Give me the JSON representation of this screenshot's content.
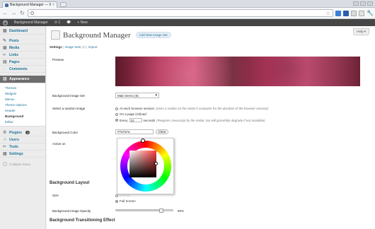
{
  "browser": {
    "tab_title": "Background Manager — W",
    "tab_close": "×",
    "address": "",
    "bookmark_star": "☆"
  },
  "adminbar": {
    "site_name": "Background Manager",
    "updates": "⟳ 1",
    "comments": "💬",
    "new": "+ New"
  },
  "sidebar": {
    "top_items": [
      {
        "label": "Dashboard",
        "icon": "dashboard-icon"
      }
    ],
    "items": [
      {
        "label": "Posts",
        "icon": "posts-icon"
      },
      {
        "label": "Media",
        "icon": "media-icon"
      },
      {
        "label": "Links",
        "icon": "links-icon"
      },
      {
        "label": "Pages",
        "icon": "pages-icon"
      },
      {
        "label": "Comments",
        "icon": "comments-icon"
      }
    ],
    "appearance": {
      "label": "Appearance",
      "icon": "appearance-icon"
    },
    "submenu": [
      "Themes",
      "Widgets",
      "Menus",
      "Theme Options",
      "Header",
      "Background",
      "Editor"
    ],
    "submenu_current": "Background",
    "plugins": {
      "label": "Plugins",
      "badge": "1"
    },
    "users": {
      "label": "Users"
    },
    "tools": {
      "label": "Tools"
    },
    "settings": {
      "label": "Settings"
    },
    "collapse": "Collapse menu"
  },
  "main": {
    "help": "Help ▾",
    "page_title": "Background Manager",
    "add_new": "Add New Image Set",
    "subsub": {
      "settings": "Settings",
      "sep1": "|",
      "image_sets": "Image Sets",
      "image_sets_count": "(4)",
      "sep2": "|",
      "import": "Import"
    },
    "preview_label": "Preview",
    "image_set_label": "Background Image Set",
    "image_set_value": "Main Demo (5)",
    "random_label": "Select a random image",
    "random_options": [
      {
        "label": "At each browser session",
        "note": "(Uses a cookie on the visitor's computer for the duration of the browser session)",
        "checked": false
      },
      {
        "label": "On a page (re)load",
        "note": "",
        "checked": false
      }
    ],
    "every_label": "Every",
    "every_value": "10",
    "every_suffix": "seconds",
    "every_note": "(Requires Javascript by the visitor, but will gracefully degrade if not available)",
    "color_label": "Background Color",
    "color_value": "#7a7a7a",
    "clear_button": "Clear",
    "active_on_label": "Active on",
    "layout_heading": "Background Layout",
    "size_label": "Size",
    "size_options": [
      {
        "label": "Normal",
        "checked": false
      },
      {
        "label": "Full Screen",
        "checked": true
      }
    ],
    "opacity_label": "Background Image Opacity",
    "opacity_value": "80%",
    "opacity_fraction": 0.8,
    "transition_heading": "Background Transitioning Effect"
  }
}
